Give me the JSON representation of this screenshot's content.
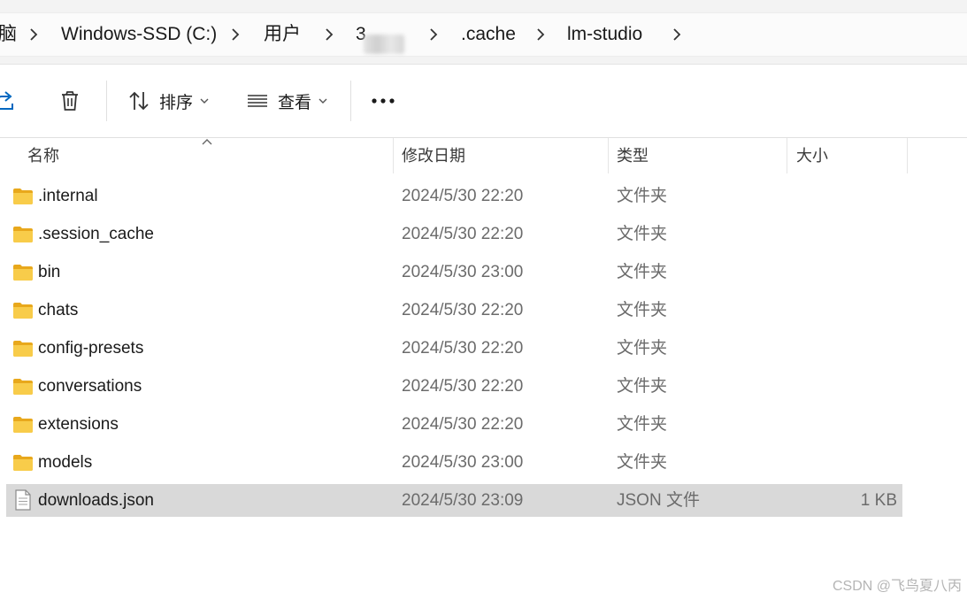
{
  "breadcrumb": {
    "items": [
      {
        "label": "脑"
      },
      {
        "label": "Windows-SSD (C:)"
      },
      {
        "label": "用户"
      },
      {
        "label": "3"
      },
      {
        "label": ".cache"
      },
      {
        "label": "lm-studio"
      }
    ]
  },
  "toolbar": {
    "share_icon": "share-icon",
    "delete_icon": "trash-icon",
    "sort_label": "排序",
    "view_label": "查看",
    "more_icon": "more-icon"
  },
  "columns": {
    "name": "名称",
    "date": "修改日期",
    "type": "类型",
    "size": "大小"
  },
  "files": [
    {
      "name": ".internal",
      "date": "2024/5/30 22:20",
      "type": "文件夹",
      "size": "",
      "icon": "folder-icon"
    },
    {
      "name": ".session_cache",
      "date": "2024/5/30 22:20",
      "type": "文件夹",
      "size": "",
      "icon": "folder-icon"
    },
    {
      "name": "bin",
      "date": "2024/5/30 23:00",
      "type": "文件夹",
      "size": "",
      "icon": "folder-icon"
    },
    {
      "name": "chats",
      "date": "2024/5/30 22:20",
      "type": "文件夹",
      "size": "",
      "icon": "folder-icon"
    },
    {
      "name": "config-presets",
      "date": "2024/5/30 22:20",
      "type": "文件夹",
      "size": "",
      "icon": "folder-icon"
    },
    {
      "name": "conversations",
      "date": "2024/5/30 22:20",
      "type": "文件夹",
      "size": "",
      "icon": "folder-icon"
    },
    {
      "name": "extensions",
      "date": "2024/5/30 22:20",
      "type": "文件夹",
      "size": "",
      "icon": "folder-icon"
    },
    {
      "name": "models",
      "date": "2024/5/30 23:00",
      "type": "文件夹",
      "size": "",
      "icon": "folder-icon"
    },
    {
      "name": "downloads.json",
      "date": "2024/5/30 23:09",
      "type": "JSON 文件",
      "size": "1 KB",
      "icon": "file-icon",
      "selected": true
    }
  ],
  "watermark": "CSDN @飞鸟夏八丙",
  "colors": {
    "selection": "#d9d9d9",
    "folder": "#f5c33b",
    "accent": "#0067c0"
  }
}
